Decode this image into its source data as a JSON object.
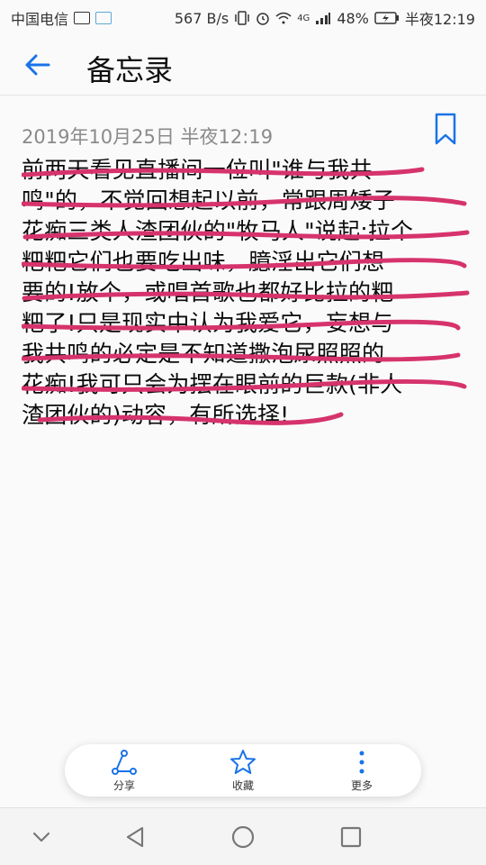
{
  "status_bar": {
    "carrier": "中国电信",
    "speed": "567 B/s",
    "network": "4G",
    "battery": "48%",
    "time": "半夜12:19"
  },
  "app_bar": {
    "title": "备忘录"
  },
  "note": {
    "date": "2019年10月25日 半夜12:19",
    "lines": [
      "前两天看见直播间一位叫\"谁与我共",
      "鸣\"的，不觉回想起以前，常跟周矮子",
      "花痴三类人渣团伙的\"牧马人\"说起:拉个",
      "粑粑它们也要吃出味，臆淫出它们想",
      "要的!放个，或唱首歌也都好比拉的粑",
      "粑了!只是现实中认为我爱它，妄想与",
      "我共鸣的必定是不知道撒泡尿照照的",
      "花痴!我可只会为摆在眼前的巨款(非人",
      "渣团伙的)动容，有所选择!"
    ]
  },
  "actions": {
    "share": "分享",
    "favorite": "收藏",
    "more": "更多"
  },
  "colors": {
    "accent": "#1a73e8",
    "strike": "#d6336c"
  }
}
